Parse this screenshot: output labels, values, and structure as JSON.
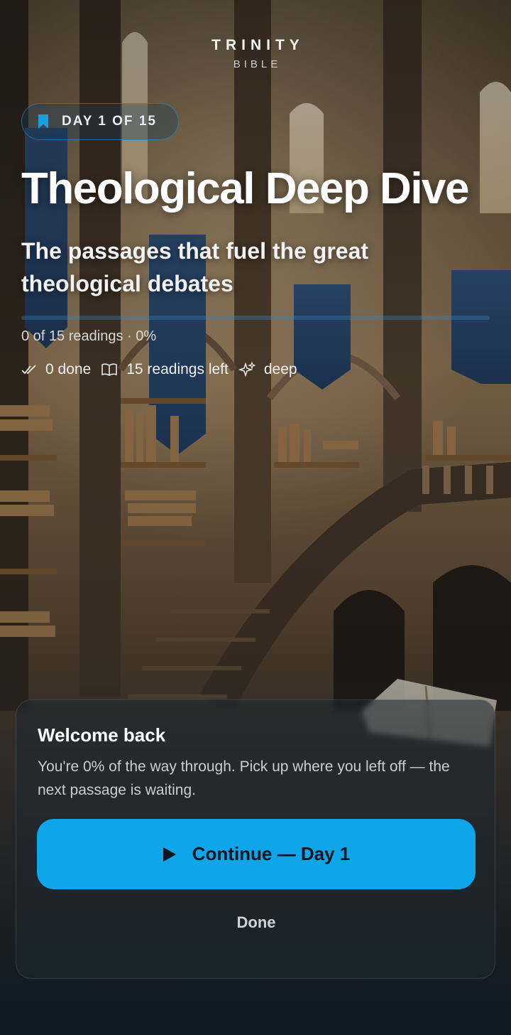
{
  "brand": {
    "name": "TRINITY",
    "sub": "BIBLE"
  },
  "badge": {
    "label": "DAY 1 OF 15",
    "icon": "bookmark-icon"
  },
  "plan": {
    "title": "Theological Deep Dive",
    "subtitle": "The passages that fuel the great theological debates"
  },
  "progress": {
    "fraction": 0.0,
    "text": "0 of 15 readings · 0%"
  },
  "meta": {
    "done": "0 done",
    "left": "15 readings left",
    "level": "deep"
  },
  "card": {
    "title": "Welcome back",
    "body": "You're 0% of the way through. Pick up where you left off — the next passage is waiting.",
    "continue_label": "Continue — Day 1",
    "done_label": "Done"
  },
  "colors": {
    "accent": "#0ea5e9"
  }
}
